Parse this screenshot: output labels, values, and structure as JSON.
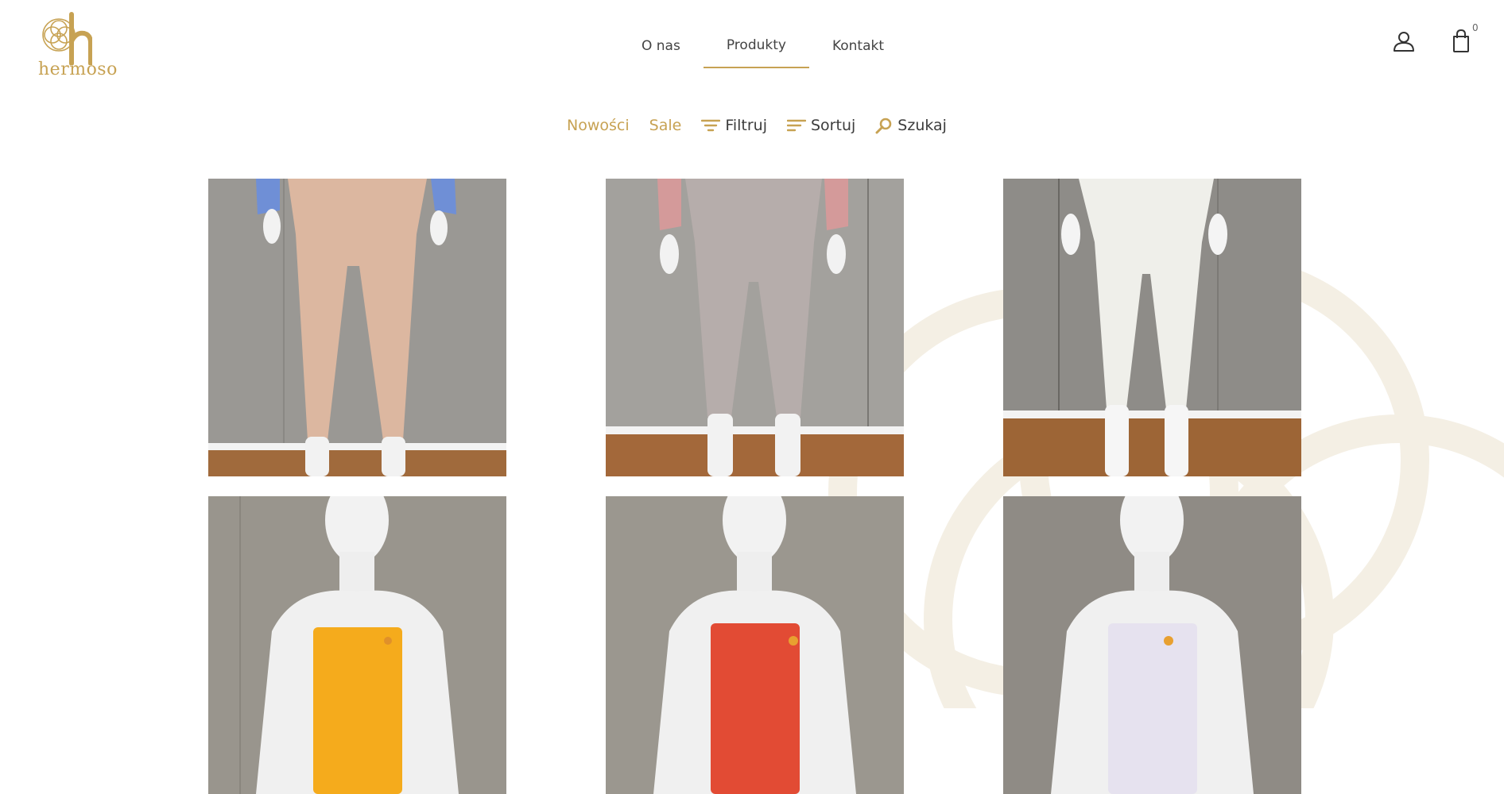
{
  "brand": {
    "name": "hermoso",
    "accent_color": "#c7a253"
  },
  "nav": {
    "items": [
      {
        "label": "O nas"
      },
      {
        "label": "Produkty",
        "active": true
      },
      {
        "label": "Kontakt"
      }
    ]
  },
  "header_icons": {
    "account_icon": "user-icon",
    "cart_icon": "shopping-bag-icon",
    "cart_count": "0"
  },
  "toolbar": {
    "new_label": "Nowości",
    "sale_label": "Sale",
    "filter_label": "Filtruj",
    "filter_icon": "filter-icon",
    "sort_label": "Sortuj",
    "sort_icon": "sort-icon",
    "search_label": "Szukaj",
    "search_icon": "search-icon"
  },
  "products": [
    {
      "kind": "trousers",
      "garment_color": "#dcb7a0",
      "sleeve_color": "#6f8fd6"
    },
    {
      "kind": "trousers",
      "garment_color": "#b6adab",
      "sleeve_color": "#d49a9a"
    },
    {
      "kind": "trousers",
      "garment_color": "#efefea",
      "sleeve_color": "#efefea"
    },
    {
      "kind": "tube-top",
      "garment_color": "#f5ab1c"
    },
    {
      "kind": "tube-top",
      "garment_color": "#e24b34"
    },
    {
      "kind": "tube-top",
      "garment_color": "#e6e2ef"
    }
  ]
}
